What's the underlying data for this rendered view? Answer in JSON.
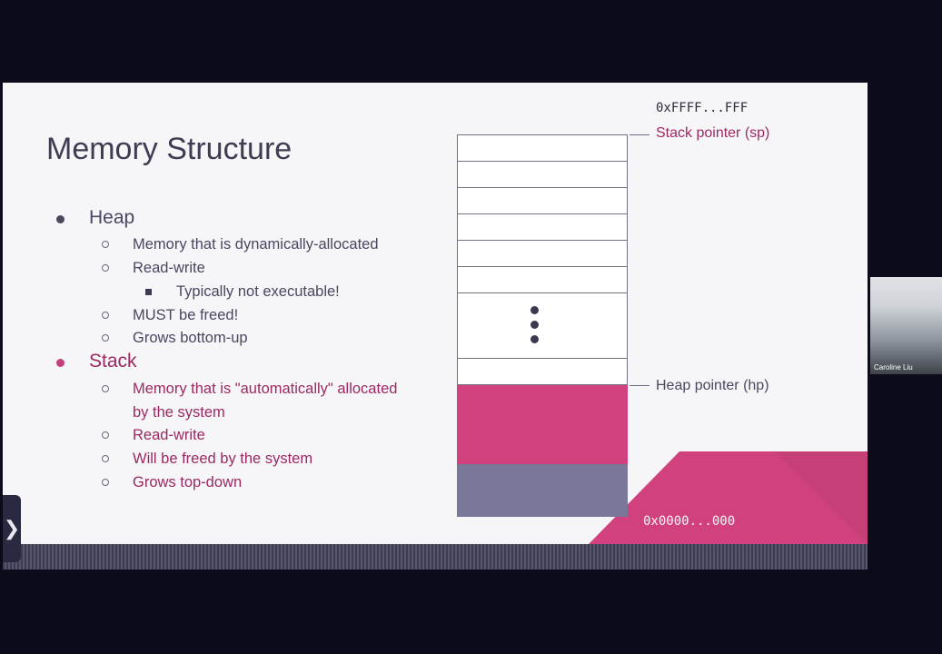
{
  "slide": {
    "title": "Memory Structure",
    "sections": [
      {
        "label": "Heap",
        "items": [
          {
            "text": "Memory that is dynamically-allocated"
          },
          {
            "text": "Read-write",
            "sub": [
              "Typically not executable!"
            ]
          },
          {
            "text": "MUST be freed!"
          },
          {
            "text": "Grows bottom-up"
          }
        ]
      },
      {
        "label": "Stack",
        "items": [
          {
            "text": "Memory that is \"automatically\" allocated",
            "text_cont": "by the system"
          },
          {
            "text": "Read-write"
          },
          {
            "text": "Will be freed by the system"
          },
          {
            "text": "Grows top-down"
          }
        ]
      }
    ],
    "diagram": {
      "top_address": "0xFFFF...FFF",
      "bottom_address": "0x0000...000",
      "stack_pointer_label": "Stack pointer (sp)",
      "heap_pointer_label": "Heap pointer (hp)"
    }
  },
  "participant": {
    "name": "Caroline Liu"
  },
  "controls": {
    "sidebar_toggle_label": "❯"
  },
  "colors": {
    "background": "#0c0b1c",
    "slide_background": "#f6f5f8",
    "heap_color": "#4a4760",
    "stack_color": "#9b2a62",
    "stack_block": "#d0417d",
    "heap_block": "#7a7898"
  }
}
